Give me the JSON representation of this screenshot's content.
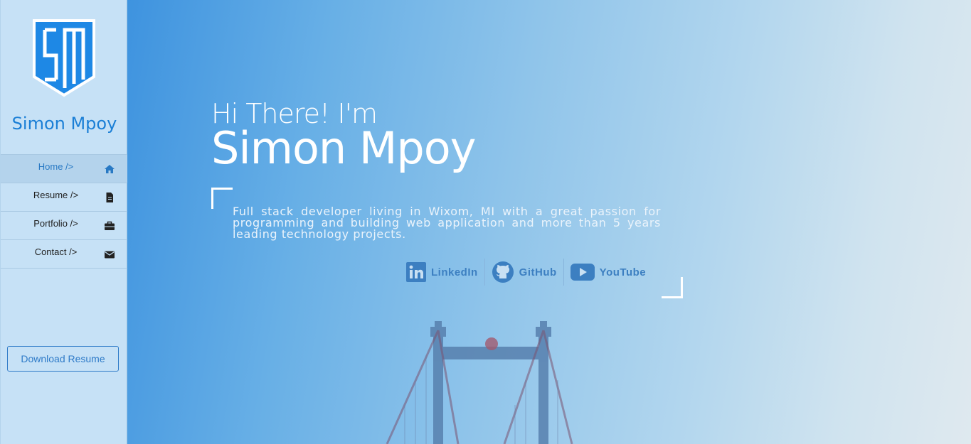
{
  "sidebar": {
    "logo_icon": "sm-shield-logo",
    "brand": "Simon Mpoy",
    "items": [
      {
        "label": "Home />",
        "icon": "home-icon",
        "active": true
      },
      {
        "label": "Resume />",
        "icon": "file-icon"
      },
      {
        "label": "Portfolio />",
        "icon": "briefcase-icon"
      },
      {
        "label": "Contact />",
        "icon": "envelope-icon"
      }
    ],
    "download_label": "Download Resume"
  },
  "hero": {
    "greeting": "Hi There! I'm",
    "name": "Simon Mpoy",
    "bio": "Full stack developer living in Wixom, MI with a great passion for programming and building web application and more than 5 years leading technology projects.",
    "socials": [
      {
        "label": "LinkedIn",
        "icon": "linkedin-icon"
      },
      {
        "label": "GitHub",
        "icon": "github-icon"
      },
      {
        "label": "YouTube",
        "icon": "youtube-icon"
      }
    ]
  },
  "colors": {
    "accent": "#1b7fd6",
    "sidebar_bg": "#c6e1f6",
    "social_text": "#3c7fc1"
  }
}
